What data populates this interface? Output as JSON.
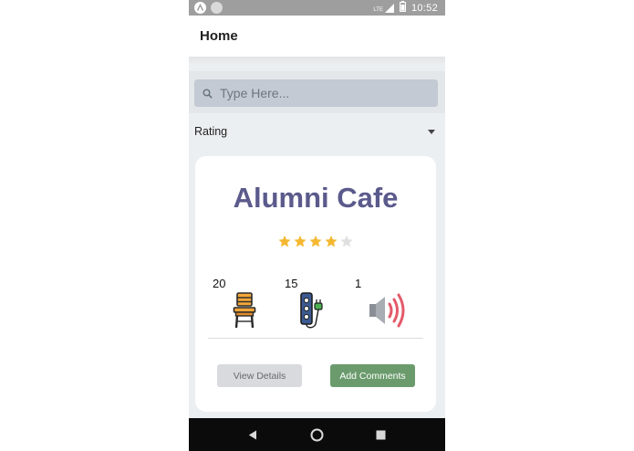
{
  "status_bar": {
    "time": "10:52",
    "network": "LTE",
    "left_icons": [
      "app-launcher-icon",
      "sync-icon"
    ],
    "right_icons": [
      "signal-icon",
      "battery-icon"
    ]
  },
  "appbar": {
    "title": "Home"
  },
  "search": {
    "placeholder": "Type Here...",
    "value": "",
    "icon": "search-icon"
  },
  "sort_dropdown": {
    "selected": "Rating"
  },
  "card": {
    "title": "Alumni Cafe",
    "rating": 4,
    "rating_max": 5,
    "colors": {
      "title": "#5b5a8c",
      "star_filled": "#f4b831",
      "star_empty": "#e0e0e0"
    },
    "amenities": [
      {
        "id": "seats",
        "count": "20",
        "icon": "chair-icon"
      },
      {
        "id": "outlets",
        "count": "15",
        "icon": "power-strip-icon"
      },
      {
        "id": "noise",
        "count": "1",
        "icon": "speaker-icon"
      }
    ],
    "buttons": {
      "view_details": "View Details",
      "add_comments": "Add Comments"
    },
    "button_colors": {
      "view_details": "#d8dadd",
      "add_comments": "#6b9b6d"
    }
  },
  "nav_bar": {
    "icons": [
      "back-icon",
      "home-icon",
      "recents-icon"
    ]
  }
}
